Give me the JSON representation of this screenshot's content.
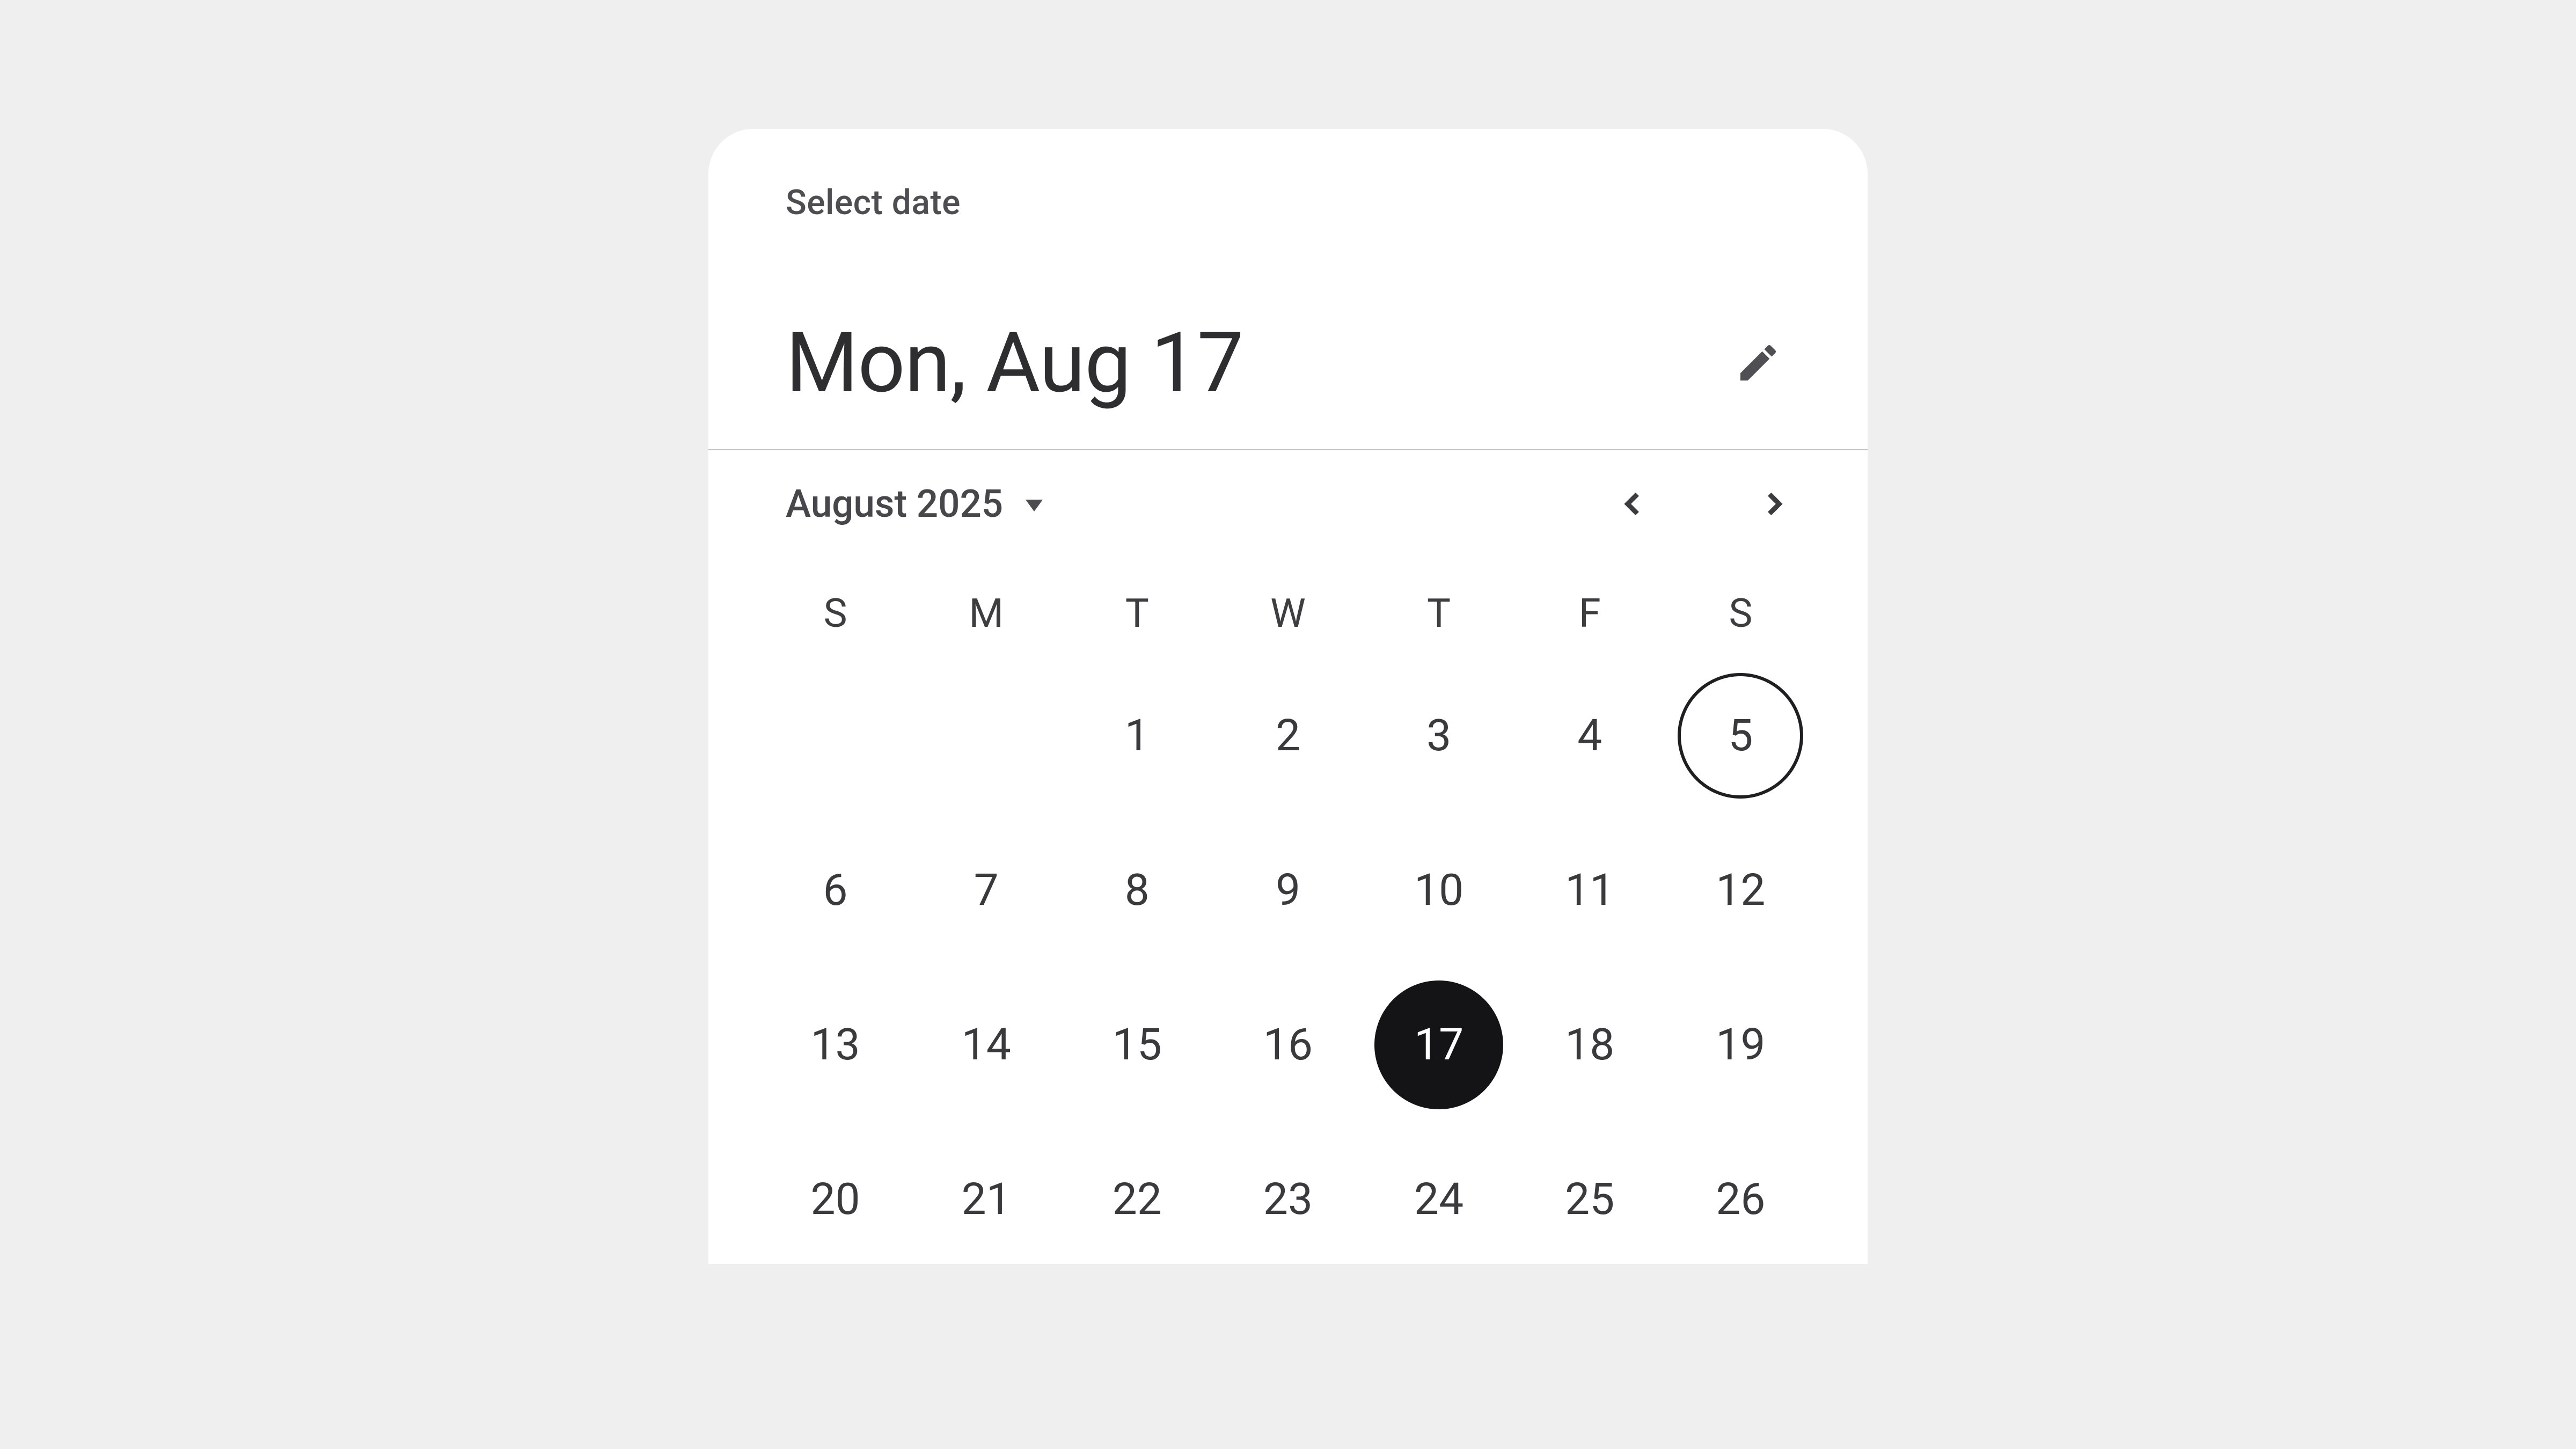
{
  "header": {
    "supertitle": "Select date",
    "headline": "Mon, Aug 17"
  },
  "monthSelector": {
    "label": "August 2025"
  },
  "dayOfWeek": [
    "S",
    "M",
    "T",
    "W",
    "T",
    "F",
    "S"
  ],
  "calendar": {
    "leadingBlanks": 2,
    "days": [
      1,
      2,
      3,
      4,
      5,
      6,
      7,
      8,
      9,
      10,
      11,
      12,
      13,
      14,
      15,
      16,
      17,
      18,
      19,
      20,
      21,
      22,
      23,
      24,
      25,
      26
    ],
    "selected": 17,
    "today": 5
  }
}
